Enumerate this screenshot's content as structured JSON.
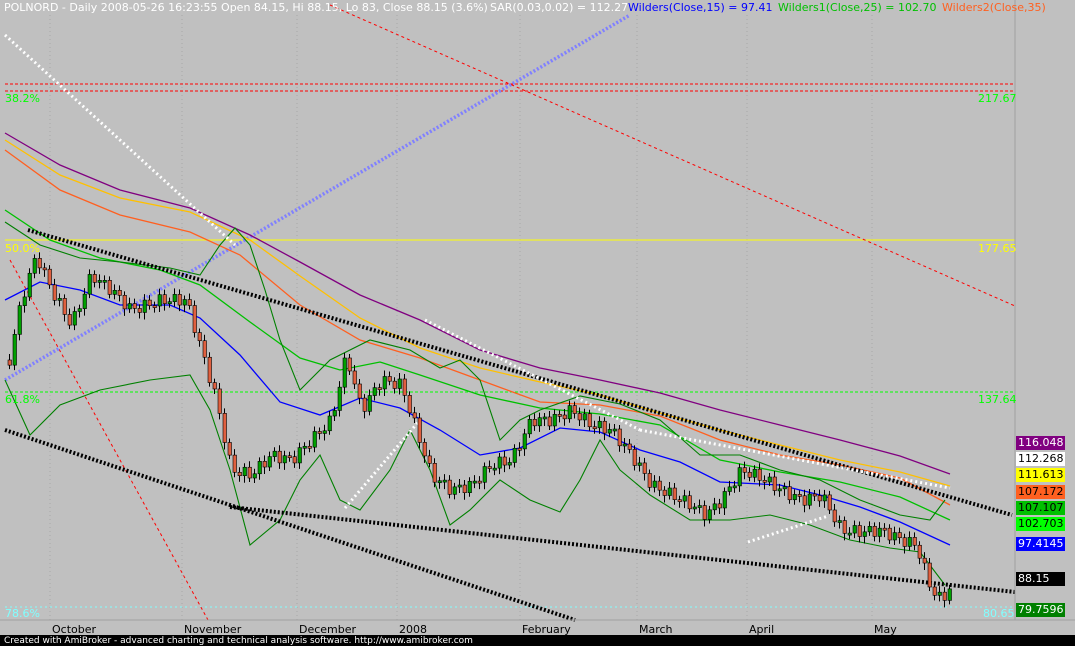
{
  "header": {
    "title": "POLNORD - Daily 2008-05-26 16:23:55 Open 84.15, Hi 88.15, Lo 83, Close 88.15 (3.6%)",
    "sar": "SAR(0.03,0.02) = 112.27",
    "wilders": "Wilders(Close,15) = 97.41",
    "wilders1": "Wilders1(Close,25) = 102.70",
    "wilders2": "Wilders2(Close,35)"
  },
  "fib": {
    "l382": "38.2%",
    "p382": "217.67",
    "l50": "50.0%",
    "p50": "177.65",
    "l618": "61.8%",
    "p618": "137.64",
    "l786": "78.6%",
    "p786": "80.65"
  },
  "price_labels": [
    {
      "text": "116.048",
      "bg": "#800080",
      "fg": "#ffffff"
    },
    {
      "text": "112.268",
      "bg": "#ffffff",
      "fg": "#000000"
    },
    {
      "text": "111.613",
      "bg": "#ffff00",
      "fg": "#000000"
    },
    {
      "text": "107.172",
      "bg": "#ff6020",
      "fg": "#000000"
    },
    {
      "text": "107.107",
      "bg": "#00c000",
      "fg": "#000000"
    },
    {
      "text": "102.703",
      "bg": "#00ff00",
      "fg": "#000000"
    },
    {
      "text": "97.4145",
      "bg": "#0000ff",
      "fg": "#ffffff"
    },
    {
      "text": "88.15",
      "bg": "#000000",
      "fg": "#ffffff"
    },
    {
      "text": "79.7596",
      "bg": "#008000",
      "fg": "#ffffff"
    }
  ],
  "x_axis": [
    "October",
    "November",
    "December",
    "2008",
    "February",
    "March",
    "April",
    "May"
  ],
  "footer": "Created with AmiBroker - advanced charting and technical analysis software. http://www.amibroker.com",
  "colors": {
    "background": "#c0c0c0",
    "up_candle": "#00a000",
    "down_candle": "#e06040",
    "sar_dots": "#ffffff",
    "wilders": "#0000ff",
    "wilders1": "#00c000",
    "wilders2": "#ff6020",
    "ma_yellow": "#ffc000",
    "ma_purple": "#800080",
    "bollinger": "#008000",
    "fib_red": "#ff0000",
    "fib_yellow": "#ffff00",
    "fib_green": "#00ff00",
    "fib_cyan": "#80ffff",
    "trend_blue": "#8080ff",
    "trend_black": "#000000"
  }
}
